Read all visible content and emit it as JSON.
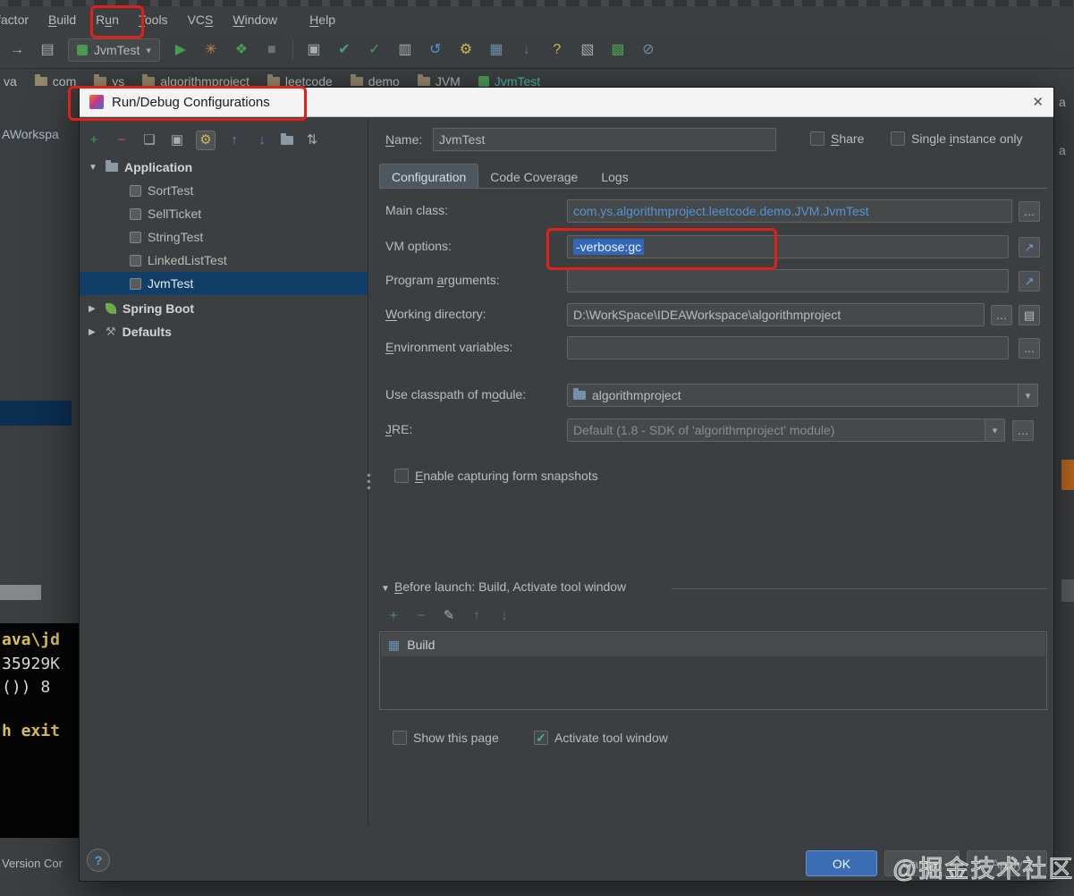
{
  "icons": {
    "close": "✕",
    "expand_arrow": "▼",
    "collapse_arrow": "▶",
    "combo_arrow": "▾",
    "help": "?",
    "check": "✓",
    "ellipsis": "…",
    "expand_editor": "↗",
    "list_button": "▤",
    "wrench": "⚒"
  },
  "window": {
    "menubar": {
      "items": [
        {
          "pre": "",
          "key": "",
          "post": "factor"
        },
        {
          "pre": "",
          "key": "B",
          "post": "uild"
        },
        {
          "pre": "R",
          "key": "u",
          "post": "n"
        },
        {
          "pre": "",
          "key": "T",
          "post": "ools"
        },
        {
          "pre": "VC",
          "key": "S",
          "post": ""
        },
        {
          "pre": "",
          "key": "W",
          "post": "indow"
        },
        {
          "pre": "",
          "key": "H",
          "post": "elp"
        }
      ]
    },
    "toolbar": {
      "run_config_label": "JvmTest",
      "icons": [
        {
          "name": "forward-icon",
          "glyph": "→"
        },
        {
          "name": "class-icon",
          "glyph": "▤"
        },
        {
          "name": "run-icon",
          "glyph": "▶"
        },
        {
          "name": "coverage-icon",
          "glyph": "✳"
        },
        {
          "name": "profile-icon",
          "glyph": "❖"
        },
        {
          "name": "stop-icon",
          "glyph": "■"
        },
        {
          "name": "editor-window-icon",
          "glyph": "▣"
        },
        {
          "name": "commit-icon",
          "glyph": "✔"
        },
        {
          "name": "update-icon",
          "glyph": "✓"
        },
        {
          "name": "structure-icon",
          "glyph": "▥"
        },
        {
          "name": "rollback-icon",
          "glyph": "↺"
        },
        {
          "name": "settings-gear-icon",
          "glyph": "⚙"
        },
        {
          "name": "module-icon",
          "glyph": "▦"
        },
        {
          "name": "download-icon",
          "glyph": "↓"
        },
        {
          "name": "help-icon",
          "glyph": "?"
        },
        {
          "name": "plugin-icon",
          "glyph": "▧"
        },
        {
          "name": "teamcity-icon",
          "glyph": "▩"
        },
        {
          "name": "no-entry-icon",
          "glyph": "⊘"
        }
      ]
    },
    "breadcrumbs": {
      "prefix": "va",
      "items": [
        "com",
        "ys",
        "algorithmproject",
        "leetcode",
        "demo",
        "JVM"
      ],
      "last": "JvmTest"
    },
    "background": {
      "project_text": "AWorkspa",
      "console": [
        "ava\\jd",
        "35929K",
        "())  8",
        "h exit"
      ],
      "status_text": "Version Cor",
      "edge_text_1": "a",
      "edge_text_2": "a"
    }
  },
  "dialog": {
    "title": "Run/Debug Configurations",
    "left": {
      "toolbar": [
        {
          "name": "add-icon",
          "glyph": "+"
        },
        {
          "name": "remove-icon",
          "glyph": "−"
        },
        {
          "name": "copy-icon",
          "glyph": "❏"
        },
        {
          "name": "save-icon",
          "glyph": "▣"
        },
        {
          "name": "edit-defaults-icon",
          "glyph": "⚙"
        },
        {
          "name": "move-up-icon",
          "glyph": "↑"
        },
        {
          "name": "move-down-icon",
          "glyph": "↓"
        },
        {
          "name": "folder-icon",
          "glyph": ""
        },
        {
          "name": "sort-icon",
          "glyph": "⇅"
        }
      ],
      "tree": {
        "root_label": "Application",
        "children": [
          "SortTest",
          "SellTicket",
          "StringTest",
          "LinkedListTest",
          "JvmTest"
        ],
        "groups": [
          {
            "label": "Spring Boot"
          },
          {
            "label": "Defaults"
          }
        ]
      }
    },
    "header": {
      "name_label": {
        "pre": "",
        "key": "N",
        "post": "ame:"
      },
      "name_value": "JvmTest",
      "share_label": {
        "pre": "",
        "key": "S",
        "post": "hare"
      },
      "single_label": {
        "pre": "Single ",
        "key": "i",
        "post": "nstance only"
      }
    },
    "tabs": [
      {
        "label": "Configuration"
      },
      {
        "label": "Code Coverage"
      },
      {
        "label": "Logs"
      }
    ],
    "form": {
      "main_class": {
        "label": "Main class:",
        "value": "com.ys.algorithmproject.leetcode.demo.JVM.JvmTest"
      },
      "vm_options": {
        "label": "VM options:",
        "value": "-verbose:gc"
      },
      "program_args": {
        "label": {
          "pre": "Program ",
          "key": "a",
          "post": "rguments:"
        },
        "value": ""
      },
      "working_dir": {
        "label": {
          "pre": "",
          "key": "W",
          "post": "orking directory:"
        },
        "value": "D:\\WorkSpace\\IDEAWorkspace\\algorithmproject"
      },
      "env_vars": {
        "label": {
          "pre": "",
          "key": "E",
          "post": "nvironment variables:"
        },
        "value": ""
      },
      "classpath": {
        "label": {
          "pre": "Use classpath of m",
          "key": "o",
          "post": "dule:"
        },
        "value": "algorithmproject"
      },
      "jre": {
        "label": {
          "pre": "",
          "key": "J",
          "post": "RE:"
        },
        "value": "Default (1.8 - SDK of 'algorithmproject' module)"
      },
      "snapshots_label": {
        "pre": "",
        "key": "E",
        "post": "nable capturing form snapshots"
      }
    },
    "before_launch": {
      "header": {
        "pre": "",
        "key": "B",
        "post": "efore launch: Build, Activate tool window"
      },
      "toolbar": [
        {
          "name": "add-icon",
          "glyph": "+"
        },
        {
          "name": "remove-icon",
          "glyph": "−"
        },
        {
          "name": "edit-icon",
          "glyph": "✎"
        },
        {
          "name": "move-up-icon",
          "glyph": "↑"
        },
        {
          "name": "move-down-icon",
          "glyph": "↓"
        }
      ],
      "items": [
        {
          "label": "Build"
        }
      ]
    },
    "footer": {
      "show_page_label": "Show this page",
      "activate_label": "Activate tool window",
      "ok": "OK",
      "cancel": "Cancel",
      "apply": "Apply"
    }
  },
  "watermark": "@掘金技术社区",
  "accent_colors": {
    "annotation_red": "#e2201a",
    "selection_blue": "#3166b8",
    "ok_button_blue": "#3a6db3",
    "main_class_blue": "#5394d6",
    "breadcrumb_teal": "#4bb6a5"
  }
}
